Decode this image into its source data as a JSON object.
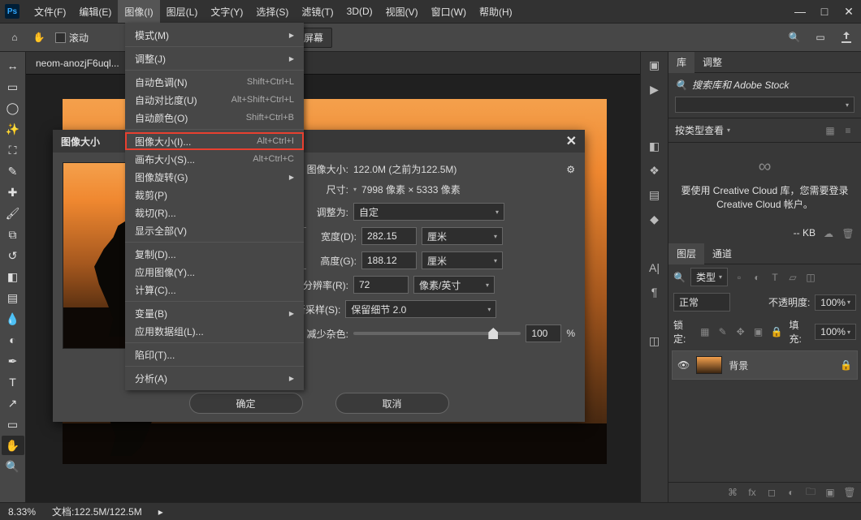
{
  "menubar": {
    "items": [
      "文件(F)",
      "编辑(E)",
      "图像(I)",
      "图层(L)",
      "文字(Y)",
      "选择(S)",
      "滤镜(T)",
      "3D(D)",
      "视图(V)",
      "窗口(W)",
      "帮助(H)"
    ],
    "active_index": 2
  },
  "optionsbar": {
    "scroll_label": "滚动",
    "fill_screen": "填充屏幕"
  },
  "doc_tab": "neom-anozjF6uql...",
  "dropdown": {
    "groups": [
      [
        {
          "label": "模式(M)",
          "sub": true
        }
      ],
      [
        {
          "label": "调整(J)",
          "sub": true
        }
      ],
      [
        {
          "label": "自动色调(N)",
          "short": "Shift+Ctrl+L"
        },
        {
          "label": "自动对比度(U)",
          "short": "Alt+Shift+Ctrl+L"
        },
        {
          "label": "自动颜色(O)",
          "short": "Shift+Ctrl+B"
        }
      ],
      [
        {
          "label": "图像大小(I)...",
          "short": "Alt+Ctrl+I",
          "hl": true
        },
        {
          "label": "画布大小(S)...",
          "short": "Alt+Ctrl+C"
        },
        {
          "label": "图像旋转(G)",
          "sub": true
        },
        {
          "label": "裁剪(P)"
        },
        {
          "label": "裁切(R)..."
        },
        {
          "label": "显示全部(V)"
        }
      ],
      [
        {
          "label": "复制(D)..."
        },
        {
          "label": "应用图像(Y)..."
        },
        {
          "label": "计算(C)..."
        }
      ],
      [
        {
          "label": "变量(B)",
          "sub": true
        },
        {
          "label": "应用数据组(L)..."
        }
      ],
      [
        {
          "label": "陷印(T)..."
        }
      ],
      [
        {
          "label": "分析(A)",
          "sub": true
        }
      ]
    ]
  },
  "dialog": {
    "title": "图像大小",
    "size_label": "图像大小:",
    "size_value": "122.0M (之前为122.5M)",
    "dim_label": "尺寸:",
    "dim_value": "7998 像素 × 5333 像素",
    "fit_label": "调整为:",
    "fit_value": "自定",
    "width_label": "宽度(D):",
    "width_value": "282.15",
    "width_unit": "厘米",
    "height_label": "高度(G):",
    "height_value": "188.12",
    "height_unit": "厘米",
    "res_label": "分辨率(R):",
    "res_value": "72",
    "res_unit": "像素/英寸",
    "resample_label": "重新采样(S):",
    "resample_value": "保留细节 2.0",
    "noise_label": "减少杂色:",
    "noise_value": "100",
    "noise_pct": "%",
    "ok": "确定",
    "cancel": "取消"
  },
  "lib_panel": {
    "tabs": [
      "库",
      "调整"
    ],
    "search_placeholder": "搜索库和 Adobe Stock",
    "view_label": "按类型查看",
    "cc_msg": "要使用 Creative Cloud 库，您需要登录 Creative Cloud 帐户。",
    "kb": "-- KB"
  },
  "layers": {
    "tabs": [
      "图层",
      "通道"
    ],
    "type_filter": "类型",
    "blend": "正常",
    "opacity_label": "不透明度:",
    "opacity_value": "100%",
    "lock_label": "锁定:",
    "fill_label": "填充:",
    "fill_value": "100%",
    "bg_layer": "背景"
  },
  "status": {
    "zoom": "8.33%",
    "docinfo": "文档:122.5M/122.5M"
  }
}
